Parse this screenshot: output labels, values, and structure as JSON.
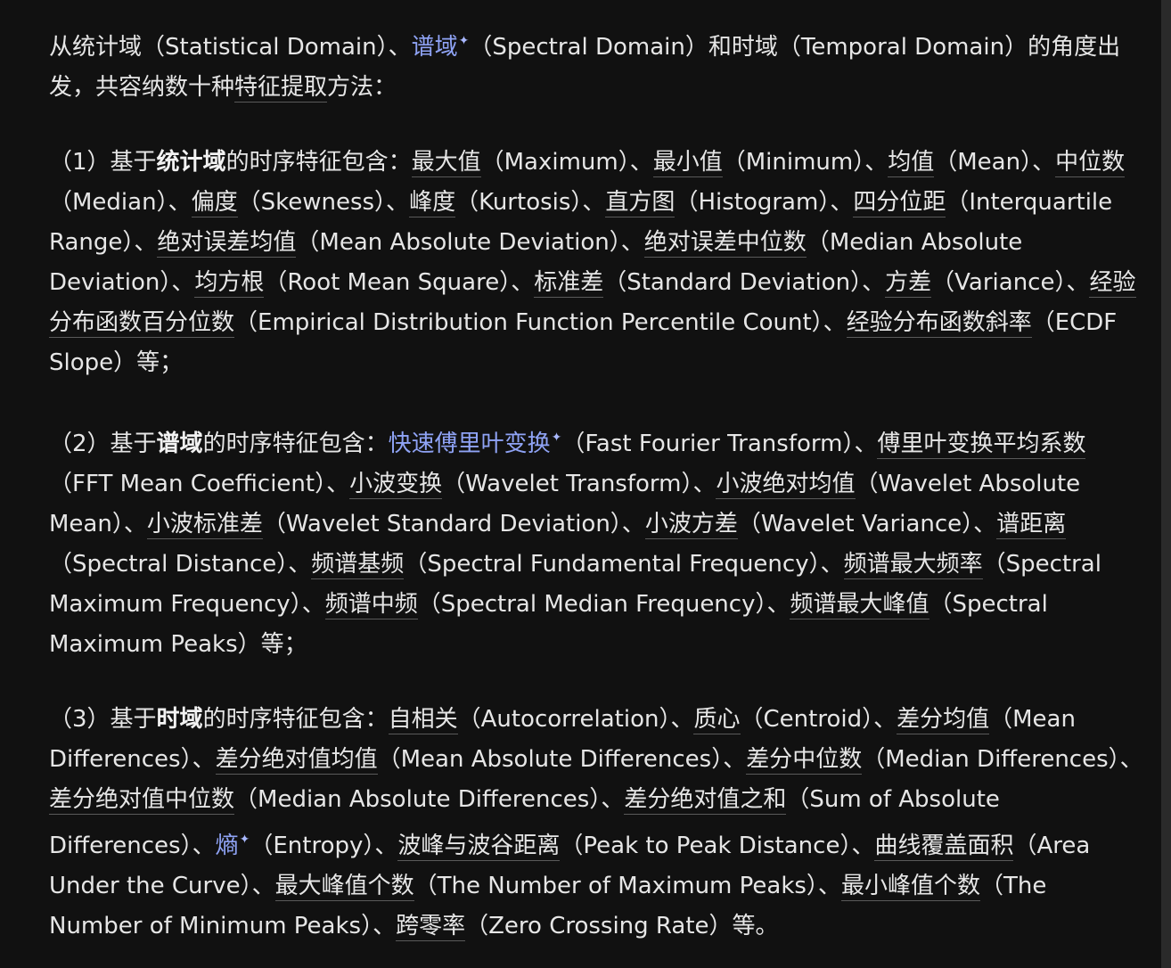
{
  "intro": {
    "t1": "从统计域（Statistical Domain）、",
    "link_spectral": "谱域",
    "t2": "（Spectral Domain）和时域（Temporal Domain）的角度出发，共容纳数十种",
    "u_feature": "特征提取",
    "t3": "方法："
  },
  "p1": {
    "prefix": "（1）基于",
    "bold": "统计域",
    "mid": "的时序特征包含：",
    "items": [
      {
        "term": "最大值",
        "desc": "（Maximum）、"
      },
      {
        "term": "最小值",
        "desc": "（Minimum）、"
      },
      {
        "term": "均值",
        "desc": "（Mean）、"
      },
      {
        "term": "中位数",
        "desc": "（Median）、"
      },
      {
        "term": "偏度",
        "desc": "（Skewness）、"
      },
      {
        "term": "峰度",
        "desc": "（Kurtosis）、"
      },
      {
        "term": "直方图",
        "desc": "（Histogram）、"
      },
      {
        "term": "四分位距",
        "desc": "（Interquartile Range）、"
      },
      {
        "term": "绝对误差均值",
        "desc": "（Mean Absolute Deviation）、"
      },
      {
        "term": "绝对误差中位数",
        "desc": "（Median Absolute Deviation）、"
      },
      {
        "term": "均方根",
        "desc": "（Root Mean Square）、"
      },
      {
        "term": "标准差",
        "desc": "（Standard Deviation）、"
      },
      {
        "term": "方差",
        "desc": "（Variance）、"
      },
      {
        "term": "经验分布函数百分位数",
        "desc": "（Empirical Distribution Function Percentile Count）、"
      },
      {
        "term": "经验分布函数斜率",
        "desc": "（ECDF Slope）等；"
      }
    ]
  },
  "p2": {
    "prefix": "（2）基于",
    "bold": "谱域",
    "mid": "的时序特征包含：",
    "link_fft": "快速傅里叶变换",
    "fft_desc": "（Fast Fourier Transform）、",
    "items": [
      {
        "term": "傅里叶变换平均系数",
        "desc": "（FFT Mean Coefficient）、"
      },
      {
        "term": "小波变换",
        "desc": "（Wavelet Transform）、"
      },
      {
        "term": "小波绝对均值",
        "desc": "（Wavelet Absolute Mean）、"
      },
      {
        "term": "小波标准差",
        "desc": "（Wavelet Standard Deviation）、"
      },
      {
        "term": "小波方差",
        "desc": "（Wavelet Variance）、"
      },
      {
        "term": "谱距离",
        "desc": "（Spectral Distance）、"
      },
      {
        "term": "频谱基频",
        "desc": "（Spectral Fundamental Frequency）、"
      },
      {
        "term": "频谱最大频率",
        "desc": "（Spectral Maximum Frequency）、"
      },
      {
        "term": "频谱中频",
        "desc": "（Spectral Median Frequency）、"
      },
      {
        "term": "频谱最大峰值",
        "desc": "（Spectral Maximum Peaks）等；"
      }
    ]
  },
  "p3": {
    "prefix": "（3）基于",
    "bold": "时域",
    "mid": "的时序特征包含：",
    "items_a": [
      {
        "term": "自相关",
        "desc": "（Autocorrelation）、"
      },
      {
        "term": "质心",
        "desc": "（Centroid）、"
      },
      {
        "term": "差分均值",
        "desc": "（Mean Differences）、"
      },
      {
        "term": "差分绝对值均值",
        "desc": "（Mean Absolute Differences）、"
      },
      {
        "term": "差分中位数",
        "desc": "（Median Differences）、"
      },
      {
        "term": "差分绝对值中位数",
        "desc": "（Median Absolute Differences）、"
      },
      {
        "term": "差分绝对值之和",
        "desc": "（Sum of Absolute Differences）、"
      }
    ],
    "link_entropy": "熵",
    "entropy_desc": "（Entropy）、",
    "items_b": [
      {
        "term": "波峰与波谷距离",
        "desc": "（Peak to Peak Distance）、"
      },
      {
        "term": "曲线覆盖面积",
        "desc": "（Area Under the Curve）、"
      },
      {
        "term": "最大峰值个数",
        "desc": "（The Number of Maximum Peaks）、"
      },
      {
        "term": "最小峰值个数",
        "desc": "（The Number of Minimum Peaks）、"
      },
      {
        "term": "跨零率",
        "desc": "（Zero Crossing Rate）等。"
      }
    ]
  },
  "star_glyph": "✦",
  "colors": {
    "background": "#111111",
    "text": "#e6e6e6",
    "link": "#8fa3f5"
  }
}
